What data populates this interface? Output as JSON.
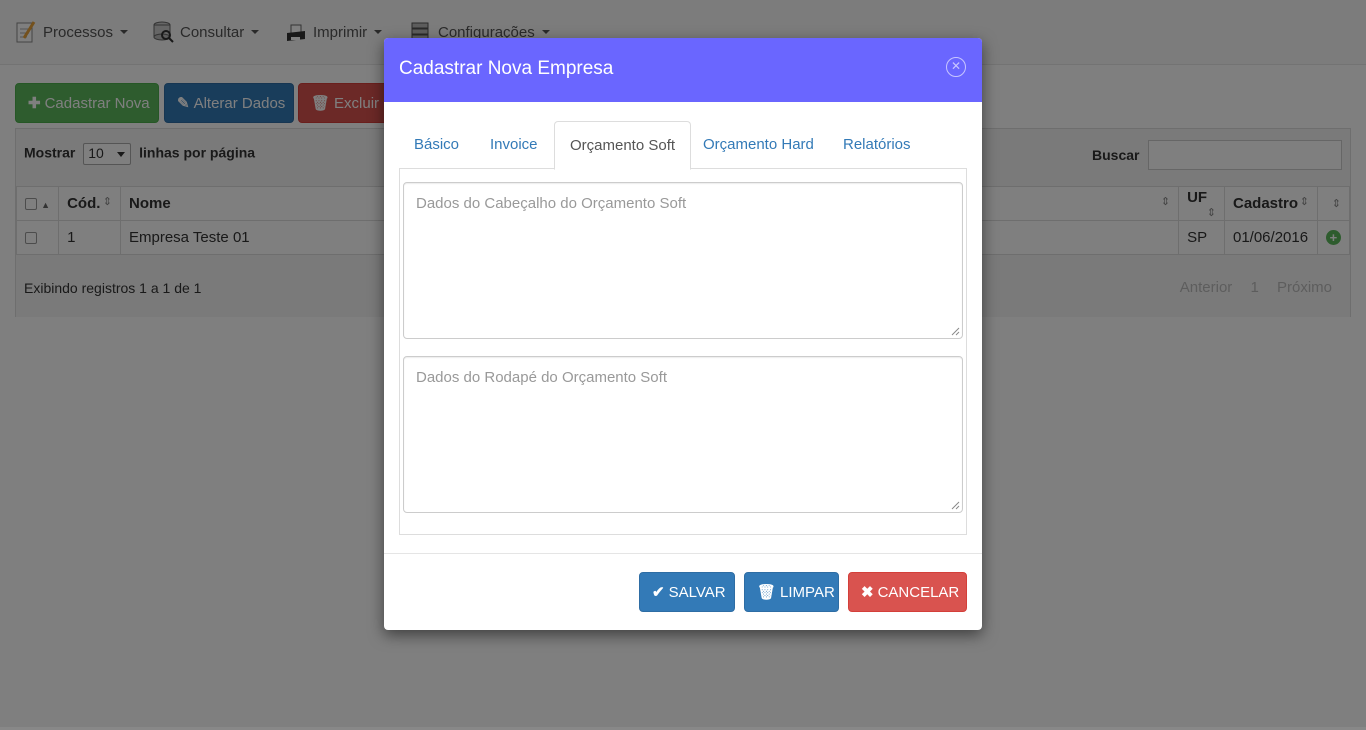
{
  "navbar": {
    "items": [
      {
        "label": "Processos",
        "icon": "notepad-pencil-icon"
      },
      {
        "label": "Consultar",
        "icon": "database-search-icon"
      },
      {
        "label": "Imprimir",
        "icon": "printer-icon"
      },
      {
        "label": "Configurações",
        "icon": "server-settings-icon"
      }
    ]
  },
  "toolbar": {
    "add_label": "Cadastrar Nova",
    "edit_label": "Alterar Dados",
    "delete_label": "Excluir R"
  },
  "grid": {
    "show_label": "Mostrar",
    "page_size": "10",
    "per_page_label": "linhas por página",
    "search_label": "Buscar",
    "columns": {
      "cod": "Cód.",
      "nome": "Nome",
      "uf": "UF",
      "cadastro": "Cadastro"
    },
    "rows": [
      {
        "cod": "1",
        "nome": "Empresa Teste 01",
        "uf": "SP",
        "cadastro": "01/06/2016"
      }
    ],
    "info": "Exibindo registros 1 a 1 de 1",
    "pager": {
      "prev": "Anterior",
      "page": "1",
      "next": "Próximo"
    }
  },
  "modal": {
    "title": "Cadastrar Nova Empresa",
    "tabs": [
      "Básico",
      "Invoice",
      "Orçamento Soft",
      "Orçamento Hard",
      "Relatórios"
    ],
    "active_tab": "Orçamento Soft",
    "header_placeholder": "Dados do Cabeçalho do Orçamento Soft",
    "footer_placeholder": "Dados do Rodapé do Orçamento Soft",
    "buttons": {
      "save": "SALVAR",
      "clear": "LIMPAR",
      "cancel": "CANCELAR"
    }
  },
  "colors": {
    "modal_header": "#6a66ff",
    "primary": "#337ab7",
    "success": "#5cb85c",
    "danger": "#d9534f"
  }
}
